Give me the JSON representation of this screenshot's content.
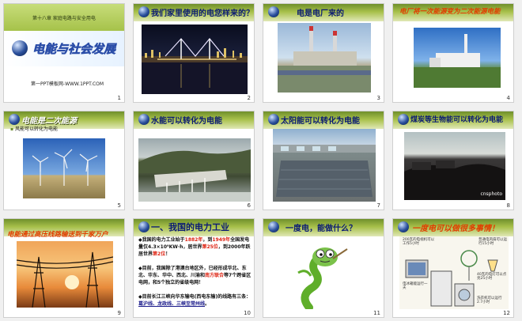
{
  "slides": [
    {
      "num": "1",
      "chapter": "第十八章 家庭电路与安全用电",
      "title": "电能与社会发展",
      "site": "第一PPT模板网-WWW.1PPT.COM"
    },
    {
      "num": "2",
      "title": "我们家里使用的电您样来的？"
    },
    {
      "num": "3",
      "title": "电是电厂来的"
    },
    {
      "num": "4",
      "title": "电厂将一次能源变为二次能源电能"
    },
    {
      "num": "5",
      "title": "电能是二次能源",
      "bullet": "风能可以转化为电能"
    },
    {
      "num": "6",
      "title": "水能可以转化为电能"
    },
    {
      "num": "7",
      "title": "太阳能可以转化为电能"
    },
    {
      "num": "8",
      "title": "煤炭等生物能可以转化为电能",
      "watermark": "cnsphoto"
    },
    {
      "num": "9",
      "title": "电能通过高压线路输送到千家万户"
    },
    {
      "num": "10",
      "title": "一、我国的电力工业",
      "b1": [
        "我国的电力工业始于",
        "1882年",
        "，到",
        "1949年",
        "全国发电量仅4.3×10⁹KW·h，居世界",
        "第25位",
        "，到2000年跃居世界",
        "第2位",
        "！"
      ],
      "b2": [
        "目前，我国除了港澳台地区外，已经形成华北、东北、华东、华中、西北、川渝和",
        "南方联合",
        "等7个跨省区电网，和5个独立的省级电网！"
      ],
      "b3": [
        "目前长江三峡向华东输电(西电东输)的线路有三条：",
        "葛沪线、龙政线、三峡至常州线",
        "。"
      ]
    },
    {
      "num": "11",
      "title": "一度电，能做什么？"
    },
    {
      "num": "12",
      "title": "一度电可以做很多事情！",
      "labels": [
        "200瓦的电视机可以工作5小时",
        "普通电风扇可以运行15小时",
        "40瓦的电灯可以点亮25小时",
        "电冰箱能运行一天",
        "洗衣机可以运行2.7小时"
      ]
    }
  ]
}
